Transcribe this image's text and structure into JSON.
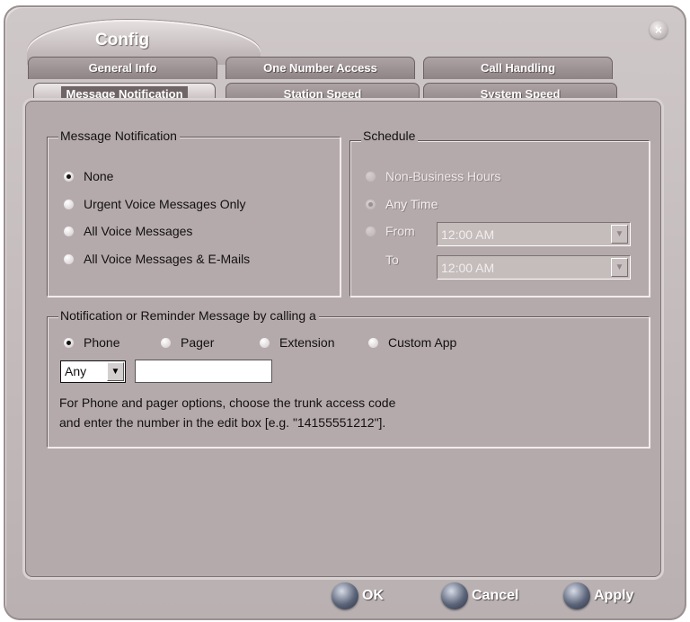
{
  "window": {
    "title": "Config",
    "close_glyph": "×"
  },
  "tabs": {
    "row1": [
      "General Info",
      "One Number Access",
      "Call Handling"
    ],
    "row2": [
      "Message Notification",
      "Station Speed",
      "System Speed"
    ],
    "active": "Message Notification"
  },
  "message_notification": {
    "title": "Message Notification",
    "options": [
      "None",
      "Urgent Voice Messages Only",
      "All Voice Messages",
      "All Voice Messages & E-Mails"
    ],
    "selected": "None"
  },
  "schedule": {
    "title": "Schedule",
    "options": [
      "Non-Business Hours",
      "Any Time",
      "From"
    ],
    "selected": "Any Time",
    "to_label": "To",
    "from_time": "12:00 AM",
    "to_time": "12:00 AM"
  },
  "notification_call": {
    "title": "Notification or Reminder Message  by calling a",
    "options": [
      "Phone",
      "Pager",
      "Extension",
      "Custom App"
    ],
    "selected": "Phone",
    "trunk_code": "Any",
    "number_value": "",
    "hint_line1": "For Phone and pager options, choose the trunk access code",
    "hint_line2": "and enter the number in the edit box [e.g. \"14155551212\"]."
  },
  "buttons": {
    "ok": "OK",
    "cancel": "Cancel",
    "apply": "Apply"
  },
  "icons": {
    "dropdown_arrow": "▼"
  },
  "colors": {
    "window_bg": "#b5aaab",
    "tab_bg": "#8f8485",
    "button_ball": "#5b6479"
  }
}
